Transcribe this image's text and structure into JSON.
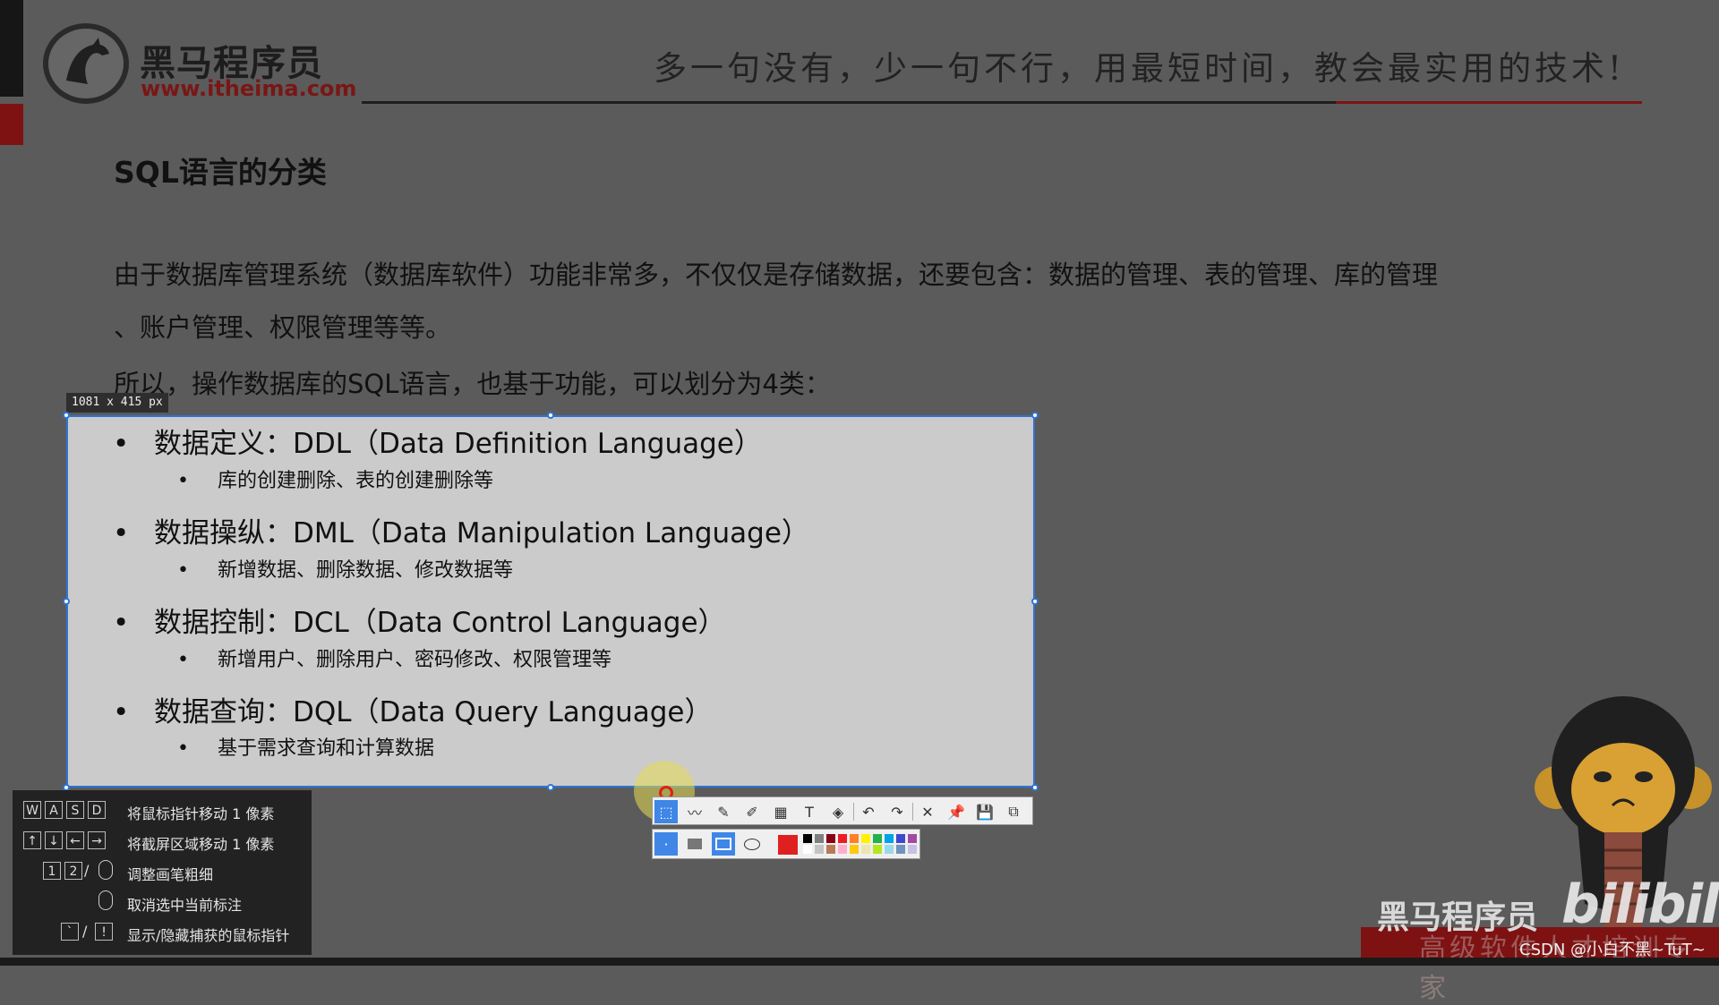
{
  "brand": {
    "name_cn": "黑马程序员",
    "url": "www.itheima.com",
    "slogan": "多一句没有，少一句不行，用最短时间，教会最实用的技术!"
  },
  "slide": {
    "title": "SQL语言的分类",
    "para_line1": "由于数据库管理系统（数据库软件）功能非常多，不仅仅是存储数据，还要包含：数据的管理、表的管理、库的管理",
    "para_line2": "、账户管理、权限管理等等。",
    "para_line3": "所以，操作数据库的SQL语言，也基于功能，可以划分为4类：",
    "bullets": [
      {
        "text": "数据定义：DDL（Data Definition Language）",
        "sub": "库的创建删除、表的创建删除等"
      },
      {
        "text": "数据操纵：DML（Data Manipulation Language）",
        "sub": "新增数据、删除数据、修改数据等"
      },
      {
        "text": "数据控制：DCL（Data Control Language）",
        "sub": "新增用户、删除用户、密码修改、权限管理等"
      },
      {
        "text": "数据查询：DQL（Data Query Language）",
        "sub": "基于需求查询和计算数据"
      }
    ]
  },
  "screenshot_tool": {
    "dimension_label": "1081 x 415  px",
    "toolbar_icons": [
      "select-icon",
      "polyline-icon",
      "pen-icon",
      "marker-icon",
      "mosaic-icon",
      "text-icon",
      "eraser-icon",
      "undo-icon",
      "redo-icon",
      "close-icon",
      "pin-icon",
      "save-icon",
      "copy-icon"
    ],
    "shape_icons": [
      "dot-size-icon",
      "filled-rect-icon",
      "rect-icon",
      "ellipse-icon"
    ],
    "current_color": "#e02020",
    "palette": [
      "#000000",
      "#7f7f7f",
      "#880015",
      "#ed1c24",
      "#ff7f27",
      "#fff200",
      "#22b14c",
      "#00a2e8",
      "#3f48cc",
      "#a349a4",
      "#ffffff",
      "#c3c3c3",
      "#b97a57",
      "#ffaec9",
      "#ffc90e",
      "#efe4b0",
      "#b5e61d",
      "#99d9ea",
      "#7092be",
      "#c8bfe7"
    ],
    "hints": [
      {
        "keys": [
          "W",
          "A",
          "S",
          "D"
        ],
        "text": "将鼠标指针移动 1 像素"
      },
      {
        "keys": [
          "↑",
          "↓",
          "←",
          "→"
        ],
        "text": "将截屏区域移动 1 像素"
      },
      {
        "keys": [
          "1",
          "2"
        ],
        "text": "调整画笔粗细"
      },
      {
        "keys": [],
        "text": "取消选中当前标注"
      },
      {
        "keys": [
          "`",
          "!"
        ],
        "text": "显示/隐藏捕获的鼠标指针"
      }
    ]
  },
  "overlay": {
    "watermark_brand": "黑马程序员",
    "bilibili": "bilibili",
    "band_text": "高级软件人才培训专家",
    "csdn": "CSDN @小白不黑~TuT~"
  }
}
